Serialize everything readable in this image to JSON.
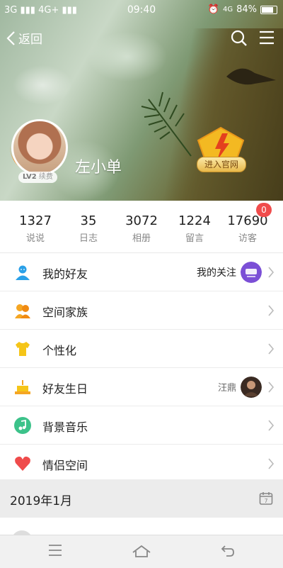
{
  "status_bar": {
    "network_left": "3G",
    "network_right": "4G+",
    "time": "09:40",
    "lte": "4G",
    "battery": "84%"
  },
  "nav": {
    "back_label": "返回"
  },
  "profile": {
    "name": "左小单",
    "vip_level": "LV2",
    "vip_action": "续费",
    "official_label": "进入官网"
  },
  "stats": [
    {
      "value": "1327",
      "label": "说说"
    },
    {
      "value": "35",
      "label": "日志"
    },
    {
      "value": "3072",
      "label": "相册"
    },
    {
      "value": "1224",
      "label": "留言"
    },
    {
      "value": "17690",
      "label": "访客"
    }
  ],
  "visitor_badge": "0",
  "menu": [
    {
      "label": "我的好友",
      "extra": "我的关注",
      "icon": "person-icon",
      "color": "#2aa0e8"
    },
    {
      "label": "空间家族",
      "icon": "family-icon",
      "color": "#f5a623"
    },
    {
      "label": "个性化",
      "icon": "shirt-icon",
      "color": "#f5c518"
    },
    {
      "label": "好友生日",
      "extra": "汪鼎",
      "icon": "cake-icon",
      "color": "#f5a623"
    },
    {
      "label": "背景音乐",
      "icon": "music-icon",
      "color": "#3cc28a"
    },
    {
      "label": "情侣空间",
      "icon": "heart-icon",
      "color": "#ef4b4b"
    }
  ],
  "feed": {
    "date": "2019年1月"
  }
}
